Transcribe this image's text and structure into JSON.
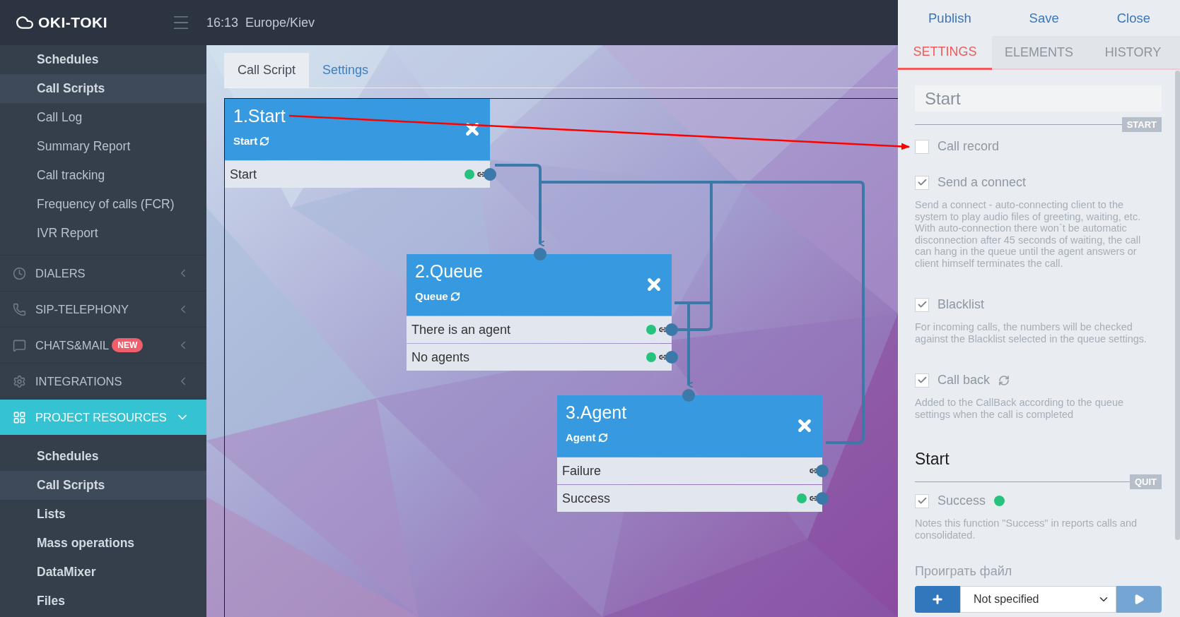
{
  "topbar": {
    "logo": "OKI-TOKI",
    "time": "16:13",
    "timezone": "Europe/Kiev"
  },
  "sidebar": {
    "items": [
      {
        "label": "Schedules",
        "kind": "primary",
        "selected": false
      },
      {
        "label": "Call Scripts",
        "kind": "primary",
        "selected": true
      },
      {
        "label": "Call Log",
        "kind": "secondary",
        "selected": false
      },
      {
        "label": "Summary Report",
        "kind": "secondary",
        "selected": false
      },
      {
        "label": "Call tracking",
        "kind": "secondary",
        "selected": false
      },
      {
        "label": "Frequency of calls (FCR)",
        "kind": "secondary",
        "selected": false
      },
      {
        "label": "IVR Report",
        "kind": "secondary",
        "selected": false
      }
    ],
    "sections": [
      {
        "label": "DIALERS",
        "selected": false,
        "expanded": false
      },
      {
        "label": "SIP-TELEPHONY",
        "selected": false,
        "expanded": false
      },
      {
        "label": "CHATS&MAIL",
        "badge": "NEW",
        "selected": false,
        "expanded": false
      },
      {
        "label": "INTEGRATIONS",
        "selected": false,
        "expanded": false
      },
      {
        "label": "PROJECT RESOURCES",
        "selected": true,
        "expanded": true,
        "children": [
          {
            "label": "Schedules",
            "selected": false
          },
          {
            "label": "Call Scripts",
            "selected": true
          },
          {
            "label": "Lists",
            "selected": false
          },
          {
            "label": "Mass operations",
            "selected": false
          },
          {
            "label": "DataMixer",
            "selected": false
          },
          {
            "label": "Files",
            "selected": false
          }
        ]
      }
    ]
  },
  "editor": {
    "tabs": [
      {
        "label": "Call Script",
        "selected": true
      },
      {
        "label": "Settings",
        "selected": false
      }
    ],
    "nodes": [
      {
        "title": "1.Start",
        "type": "Start",
        "rows": [
          {
            "label": "Start",
            "marked": true
          }
        ]
      },
      {
        "title": "2.Queue",
        "type": "Queue",
        "rows": [
          {
            "label": "There is an agent",
            "marked": true
          },
          {
            "label": "No agents",
            "marked": true
          }
        ]
      },
      {
        "title": "3.Agent",
        "type": "Agent",
        "rows": [
          {
            "label": "Failure",
            "marked": false
          },
          {
            "label": "Success",
            "marked": true
          }
        ]
      }
    ]
  },
  "panel": {
    "actions": [
      "Publish",
      "Save",
      "Close"
    ],
    "tabs": [
      {
        "label": "SETTINGS",
        "selected": true
      },
      {
        "label": "ELEMENTS",
        "selected": false
      },
      {
        "label": "HISTORY",
        "selected": false
      }
    ],
    "name_field": {
      "value": "Start"
    },
    "section_badge": "START",
    "options": [
      {
        "label": "Call record",
        "checked": false
      },
      {
        "label": "Send a connect",
        "checked": true,
        "description": "Send a connect - auto-connecting client to the system to play audio files of greeting, waiting, etc. With auto-connection there won`t be automatic disconnection after 45 seconds of waiting, the call can hang in the queue until the agent answers or client himself terminates the call."
      },
      {
        "label": "Blacklist",
        "checked": true,
        "description": "For incoming calls, the numbers will be checked against the Blacklist selected in the queue settings."
      },
      {
        "label": "Call back",
        "checked": true,
        "description": "Added to the CallBack according to the queue settings when the call is completed"
      }
    ],
    "exit_title": "Start",
    "exit_badge": "QUIT",
    "exit_options": [
      {
        "label": "Success",
        "checked": true,
        "marked": true,
        "description": "Notes this function \"Success\" in reports calls and consolidated."
      }
    ],
    "file_label": "Проиграть файл",
    "file_select": {
      "value": "Not specified"
    }
  }
}
